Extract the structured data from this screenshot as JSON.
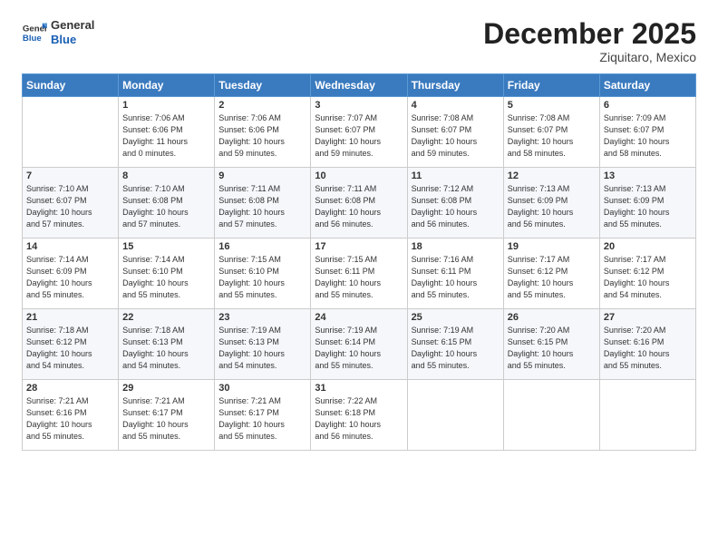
{
  "header": {
    "logo_line1": "General",
    "logo_line2": "Blue",
    "month": "December 2025",
    "location": "Ziquitaro, Mexico"
  },
  "days_of_week": [
    "Sunday",
    "Monday",
    "Tuesday",
    "Wednesday",
    "Thursday",
    "Friday",
    "Saturday"
  ],
  "weeks": [
    [
      {
        "num": "",
        "info": ""
      },
      {
        "num": "1",
        "info": "Sunrise: 7:06 AM\nSunset: 6:06 PM\nDaylight: 11 hours\nand 0 minutes."
      },
      {
        "num": "2",
        "info": "Sunrise: 7:06 AM\nSunset: 6:06 PM\nDaylight: 10 hours\nand 59 minutes."
      },
      {
        "num": "3",
        "info": "Sunrise: 7:07 AM\nSunset: 6:07 PM\nDaylight: 10 hours\nand 59 minutes."
      },
      {
        "num": "4",
        "info": "Sunrise: 7:08 AM\nSunset: 6:07 PM\nDaylight: 10 hours\nand 59 minutes."
      },
      {
        "num": "5",
        "info": "Sunrise: 7:08 AM\nSunset: 6:07 PM\nDaylight: 10 hours\nand 58 minutes."
      },
      {
        "num": "6",
        "info": "Sunrise: 7:09 AM\nSunset: 6:07 PM\nDaylight: 10 hours\nand 58 minutes."
      }
    ],
    [
      {
        "num": "7",
        "info": "Sunrise: 7:10 AM\nSunset: 6:07 PM\nDaylight: 10 hours\nand 57 minutes."
      },
      {
        "num": "8",
        "info": "Sunrise: 7:10 AM\nSunset: 6:08 PM\nDaylight: 10 hours\nand 57 minutes."
      },
      {
        "num": "9",
        "info": "Sunrise: 7:11 AM\nSunset: 6:08 PM\nDaylight: 10 hours\nand 57 minutes."
      },
      {
        "num": "10",
        "info": "Sunrise: 7:11 AM\nSunset: 6:08 PM\nDaylight: 10 hours\nand 56 minutes."
      },
      {
        "num": "11",
        "info": "Sunrise: 7:12 AM\nSunset: 6:08 PM\nDaylight: 10 hours\nand 56 minutes."
      },
      {
        "num": "12",
        "info": "Sunrise: 7:13 AM\nSunset: 6:09 PM\nDaylight: 10 hours\nand 56 minutes."
      },
      {
        "num": "13",
        "info": "Sunrise: 7:13 AM\nSunset: 6:09 PM\nDaylight: 10 hours\nand 55 minutes."
      }
    ],
    [
      {
        "num": "14",
        "info": "Sunrise: 7:14 AM\nSunset: 6:09 PM\nDaylight: 10 hours\nand 55 minutes."
      },
      {
        "num": "15",
        "info": "Sunrise: 7:14 AM\nSunset: 6:10 PM\nDaylight: 10 hours\nand 55 minutes."
      },
      {
        "num": "16",
        "info": "Sunrise: 7:15 AM\nSunset: 6:10 PM\nDaylight: 10 hours\nand 55 minutes."
      },
      {
        "num": "17",
        "info": "Sunrise: 7:15 AM\nSunset: 6:11 PM\nDaylight: 10 hours\nand 55 minutes."
      },
      {
        "num": "18",
        "info": "Sunrise: 7:16 AM\nSunset: 6:11 PM\nDaylight: 10 hours\nand 55 minutes."
      },
      {
        "num": "19",
        "info": "Sunrise: 7:17 AM\nSunset: 6:12 PM\nDaylight: 10 hours\nand 55 minutes."
      },
      {
        "num": "20",
        "info": "Sunrise: 7:17 AM\nSunset: 6:12 PM\nDaylight: 10 hours\nand 54 minutes."
      }
    ],
    [
      {
        "num": "21",
        "info": "Sunrise: 7:18 AM\nSunset: 6:12 PM\nDaylight: 10 hours\nand 54 minutes."
      },
      {
        "num": "22",
        "info": "Sunrise: 7:18 AM\nSunset: 6:13 PM\nDaylight: 10 hours\nand 54 minutes."
      },
      {
        "num": "23",
        "info": "Sunrise: 7:19 AM\nSunset: 6:13 PM\nDaylight: 10 hours\nand 54 minutes."
      },
      {
        "num": "24",
        "info": "Sunrise: 7:19 AM\nSunset: 6:14 PM\nDaylight: 10 hours\nand 55 minutes."
      },
      {
        "num": "25",
        "info": "Sunrise: 7:19 AM\nSunset: 6:15 PM\nDaylight: 10 hours\nand 55 minutes."
      },
      {
        "num": "26",
        "info": "Sunrise: 7:20 AM\nSunset: 6:15 PM\nDaylight: 10 hours\nand 55 minutes."
      },
      {
        "num": "27",
        "info": "Sunrise: 7:20 AM\nSunset: 6:16 PM\nDaylight: 10 hours\nand 55 minutes."
      }
    ],
    [
      {
        "num": "28",
        "info": "Sunrise: 7:21 AM\nSunset: 6:16 PM\nDaylight: 10 hours\nand 55 minutes."
      },
      {
        "num": "29",
        "info": "Sunrise: 7:21 AM\nSunset: 6:17 PM\nDaylight: 10 hours\nand 55 minutes."
      },
      {
        "num": "30",
        "info": "Sunrise: 7:21 AM\nSunset: 6:17 PM\nDaylight: 10 hours\nand 55 minutes."
      },
      {
        "num": "31",
        "info": "Sunrise: 7:22 AM\nSunset: 6:18 PM\nDaylight: 10 hours\nand 56 minutes."
      },
      {
        "num": "",
        "info": ""
      },
      {
        "num": "",
        "info": ""
      },
      {
        "num": "",
        "info": ""
      }
    ]
  ]
}
